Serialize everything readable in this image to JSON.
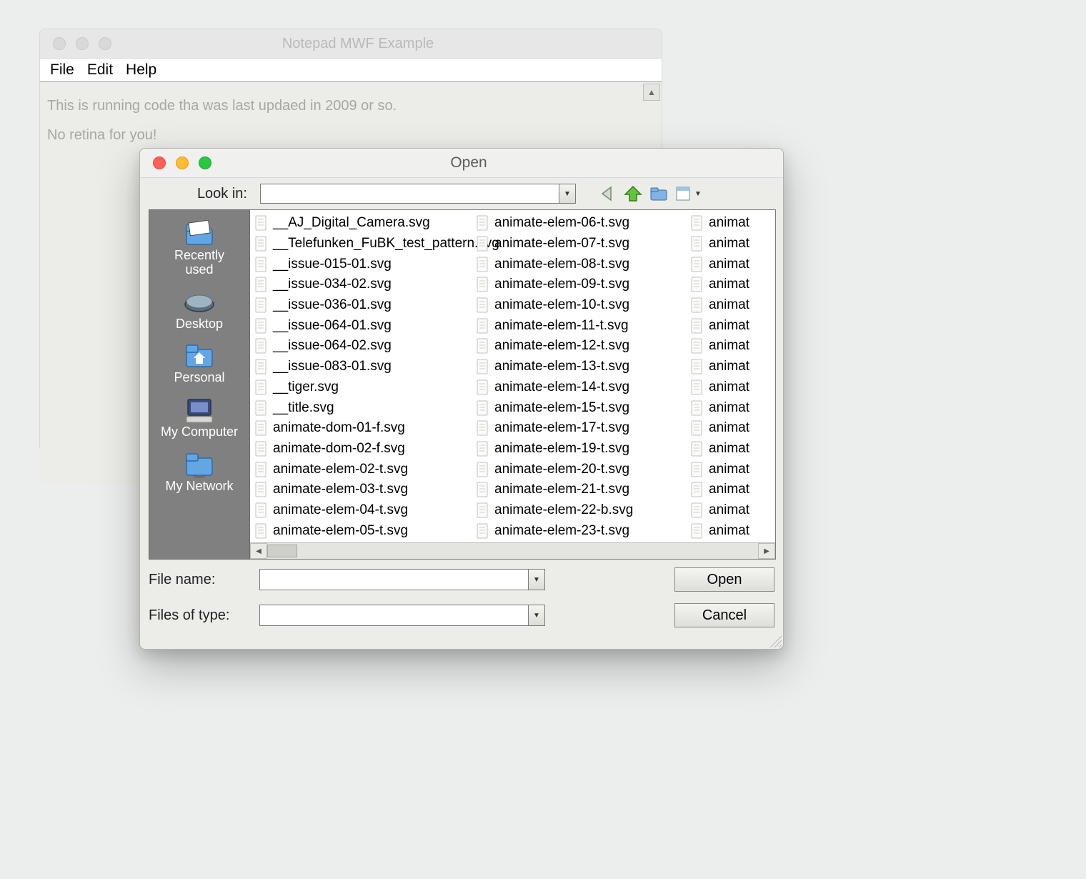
{
  "bg_window": {
    "title": "Notepad MWF Example",
    "menu": {
      "file": "File",
      "edit": "Edit",
      "help": "Help"
    },
    "body_line1": "This is running code tha  was last updaed in 2009 or so.",
    "body_line2": "No retina for you!"
  },
  "dialog": {
    "title": "Open",
    "look_in_label": "Look in:",
    "look_in_value": "",
    "places": {
      "recent": "Recently\nused",
      "desktop": "Desktop",
      "personal": "Personal",
      "computer": "My Computer",
      "network": "My Network"
    },
    "columns": [
      [
        "__AJ_Digital_Camera.svg",
        "__Telefunken_FuBK_test_pattern.svg",
        "__issue-015-01.svg",
        "__issue-034-02.svg",
        "__issue-036-01.svg",
        "__issue-064-01.svg",
        "__issue-064-02.svg",
        "__issue-083-01.svg",
        "__tiger.svg",
        "__title.svg",
        "animate-dom-01-f.svg",
        "animate-dom-02-f.svg",
        "animate-elem-02-t.svg",
        "animate-elem-03-t.svg",
        "animate-elem-04-t.svg",
        "animate-elem-05-t.svg"
      ],
      [
        "animate-elem-06-t.svg",
        "animate-elem-07-t.svg",
        "animate-elem-08-t.svg",
        "animate-elem-09-t.svg",
        "animate-elem-10-t.svg",
        "animate-elem-11-t.svg",
        "animate-elem-12-t.svg",
        "animate-elem-13-t.svg",
        "animate-elem-14-t.svg",
        "animate-elem-15-t.svg",
        "animate-elem-17-t.svg",
        "animate-elem-19-t.svg",
        "animate-elem-20-t.svg",
        "animate-elem-21-t.svg",
        "animate-elem-22-b.svg",
        "animate-elem-23-t.svg"
      ],
      [
        "animat",
        "animat",
        "animat",
        "animat",
        "animat",
        "animat",
        "animat",
        "animat",
        "animat",
        "animat",
        "animat",
        "animat",
        "animat",
        "animat",
        "animat",
        "animat"
      ]
    ],
    "file_name_label": "File name:",
    "file_name_value": "",
    "types_label": "Files of type:",
    "types_value": "",
    "open_btn": "Open",
    "cancel_btn": "Cancel"
  }
}
